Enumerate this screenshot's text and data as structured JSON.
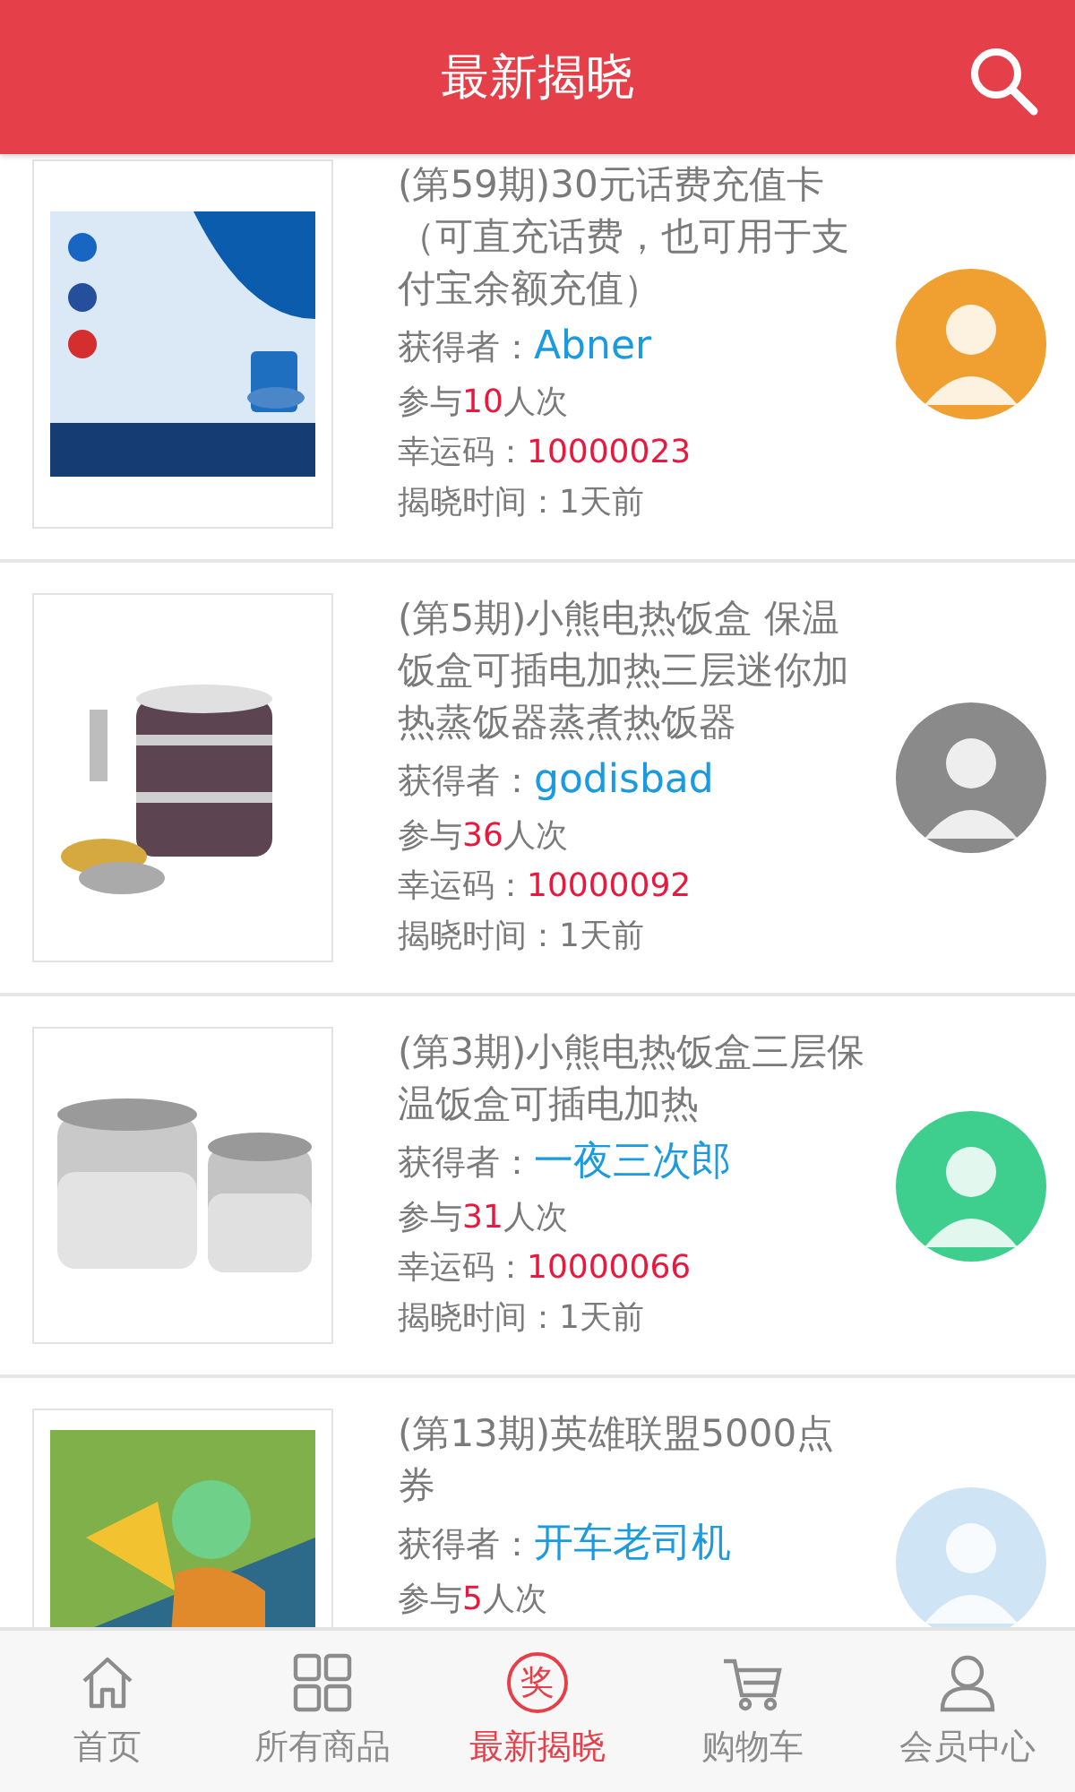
{
  "header": {
    "title": "最新揭晓"
  },
  "items": [
    {
      "title": "(第59期)30元话费充值卡（可直充话费，也可用于支付宝余额充值）",
      "winner_label": "获得者：",
      "winner": "Abner",
      "join_before": "参与",
      "join_count": "10",
      "join_after": "人次",
      "code_label": "幸运码：",
      "code": "10000023",
      "time": "揭晓时间：1天前"
    },
    {
      "title": "(第5期)小熊电热饭盒 保温饭盒可插电加热三层迷你加热蒸饭器蒸煮热饭器",
      "winner_label": "获得者：",
      "winner": "godisbad",
      "join_before": "参与",
      "join_count": "36",
      "join_after": "人次",
      "code_label": "幸运码：",
      "code": "10000092",
      "time": "揭晓时间：1天前"
    },
    {
      "title": "(第3期)小熊电热饭盒三层保温饭盒可插电加热",
      "winner_label": "获得者：",
      "winner": "一夜三次郎",
      "join_before": "参与",
      "join_count": "31",
      "join_after": "人次",
      "code_label": "幸运码：",
      "code": "10000066",
      "time": "揭晓时间：1天前"
    },
    {
      "title": "(第13期)英雄联盟5000点券",
      "winner_label": "获得者：",
      "winner": "开车老司机",
      "join_before": "参与",
      "join_count": "5",
      "join_after": "人次"
    }
  ],
  "tabs": [
    {
      "label": "首页",
      "selected": false
    },
    {
      "label": "所有商品",
      "selected": false
    },
    {
      "label": "最新揭晓",
      "selected": true,
      "badge": "奖"
    },
    {
      "label": "购物车",
      "selected": false
    },
    {
      "label": "会员中心",
      "selected": false
    }
  ]
}
